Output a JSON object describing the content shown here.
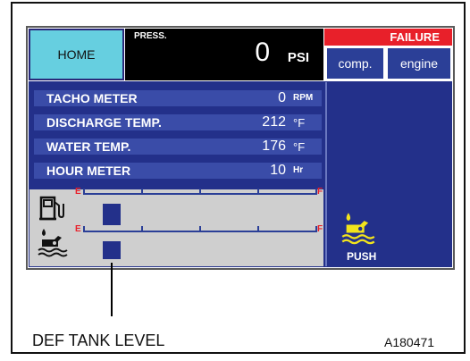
{
  "header": {
    "home_label": "HOME",
    "press_label": "PRESS.",
    "press_value": "0",
    "press_unit": "PSI",
    "failure_label": "FAILURE",
    "comp_label": "comp.",
    "engine_label": "engine"
  },
  "readouts": [
    {
      "label": "TACHO METER",
      "value": "0",
      "unit": "RPM"
    },
    {
      "label": "DISCHARGE TEMP.",
      "value": "212",
      "unit": "°F"
    },
    {
      "label": "WATER TEMP.",
      "value": "176",
      "unit": "°F"
    },
    {
      "label": "HOUR METER",
      "value": "10",
      "unit": "Hr"
    }
  ],
  "gauges": {
    "fuel": {
      "empty_label": "E",
      "full_label": "F",
      "icon": "fuel-pump-icon",
      "level": 0.1
    },
    "def": {
      "empty_label": "E",
      "full_label": "F",
      "icon": "def-fluid-icon",
      "level": 0.1
    }
  },
  "push": {
    "label": "PUSH",
    "icon": "def-fluid-icon"
  },
  "caption": "DEF TANK LEVEL",
  "figure_code": "A180471",
  "colors": {
    "panel_blue": "#23308a",
    "row_blue": "#3a4ca8",
    "home_cyan": "#66cfe0",
    "failure_red": "#e8202a",
    "icon_yellow": "#f2e41c",
    "gauge_gray": "#cfcfcf"
  }
}
